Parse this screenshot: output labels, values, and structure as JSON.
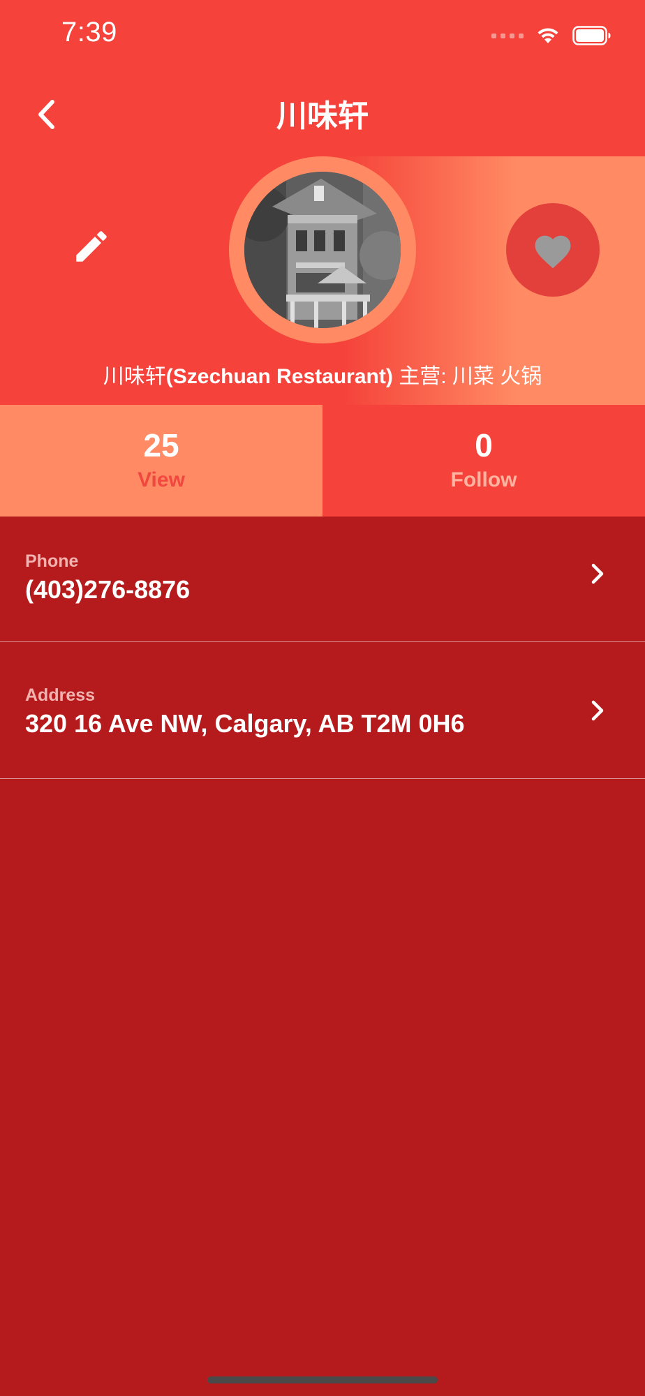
{
  "status_bar": {
    "time": "7:39"
  },
  "header": {
    "title": "川味轩",
    "back_icon": "chevron-left-icon"
  },
  "profile": {
    "name_cn": "川味轩",
    "name_en": "(Szechuan Restaurant)",
    "specialty": "主营: 川菜 火锅",
    "edit_icon": "pencil-icon",
    "favorite_icon": "heart-icon"
  },
  "stats": {
    "view": {
      "value": "25",
      "label": "View"
    },
    "follow": {
      "value": "0",
      "label": "Follow"
    }
  },
  "details": {
    "phone": {
      "label": "Phone",
      "value": "(403)276-8876"
    },
    "address": {
      "label": "Address",
      "value": "320 16 Ave NW, Calgary, AB T2M 0H6"
    }
  },
  "colors": {
    "primary": "#f5423a",
    "accent": "#ff8a63",
    "background": "#b51b1d",
    "favorite_bg": "#e4403b",
    "heart": "#9a9a9a"
  }
}
